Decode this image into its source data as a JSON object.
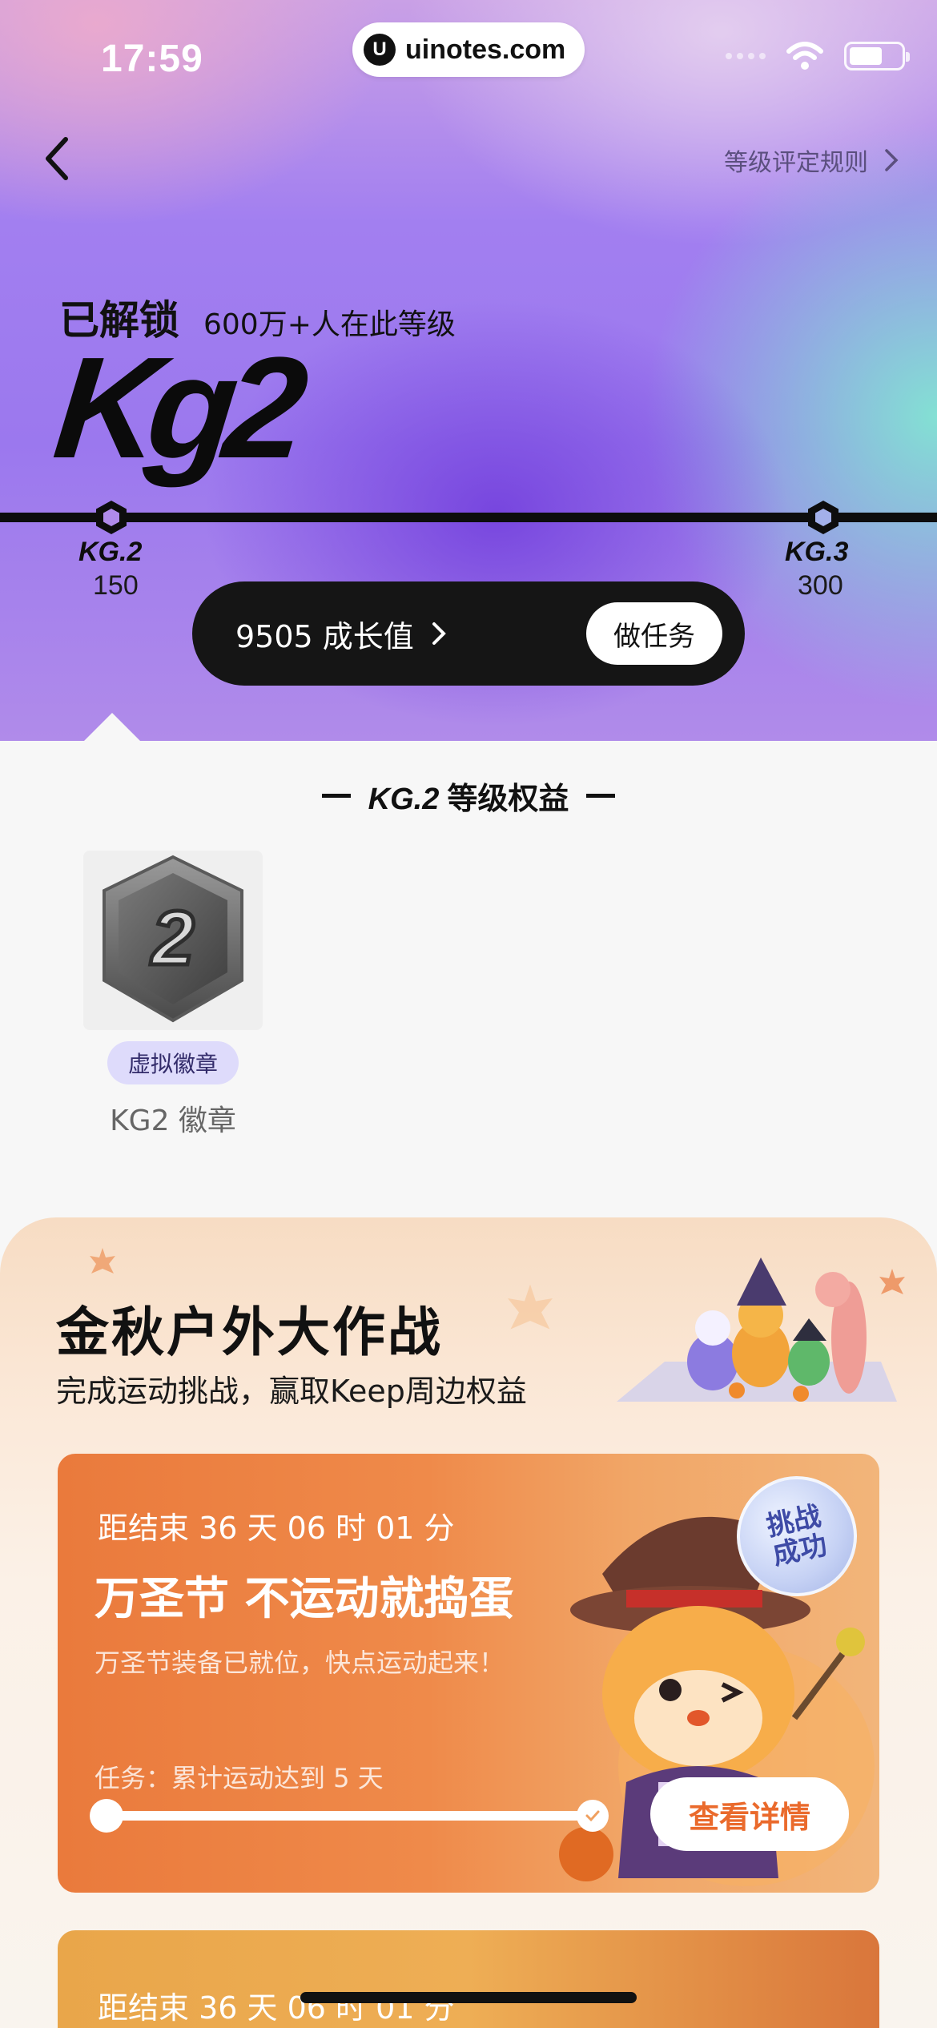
{
  "status_bar": {
    "time": "17:59",
    "url": "uinotes.com"
  },
  "header": {
    "rules_link": "等级评定规则"
  },
  "level": {
    "unlock_label": "已解锁",
    "population": "600万+人在此等级",
    "current_level": "Kg2"
  },
  "track": {
    "nodes": [
      {
        "label": "KG.2",
        "value": "150"
      },
      {
        "label": "KG.3",
        "value": "300"
      }
    ]
  },
  "growth": {
    "points": "9505 成长值",
    "task_button": "做任务"
  },
  "benefits": {
    "title_level": "KG.2",
    "title_text": "等级权益",
    "badge_digit": "2",
    "badge_tag": "虚拟徽章",
    "badge_name": "KG2 徽章"
  },
  "campaign": {
    "title": "金秋户外大作战",
    "subtitle": "完成运动挑战，赢取Keep周边权益",
    "cards": [
      {
        "countdown": "距结束 36 天 06 时 01 分",
        "title": "万圣节 不运动就捣蛋",
        "desc": "万圣节装备已就位，快点运动起来！",
        "task": "任务：累计运动达到 5 天",
        "progress": 1.0,
        "stamp_line1": "挑战",
        "stamp_line2": "成功",
        "button": "查看详情"
      },
      {
        "countdown": "距结束 36 天 06 时 01 分"
      }
    ]
  },
  "colors": {
    "accent_orange": "#ea6a2c",
    "tag_purple": "#dedbfb",
    "dark_bar": "#151515"
  }
}
